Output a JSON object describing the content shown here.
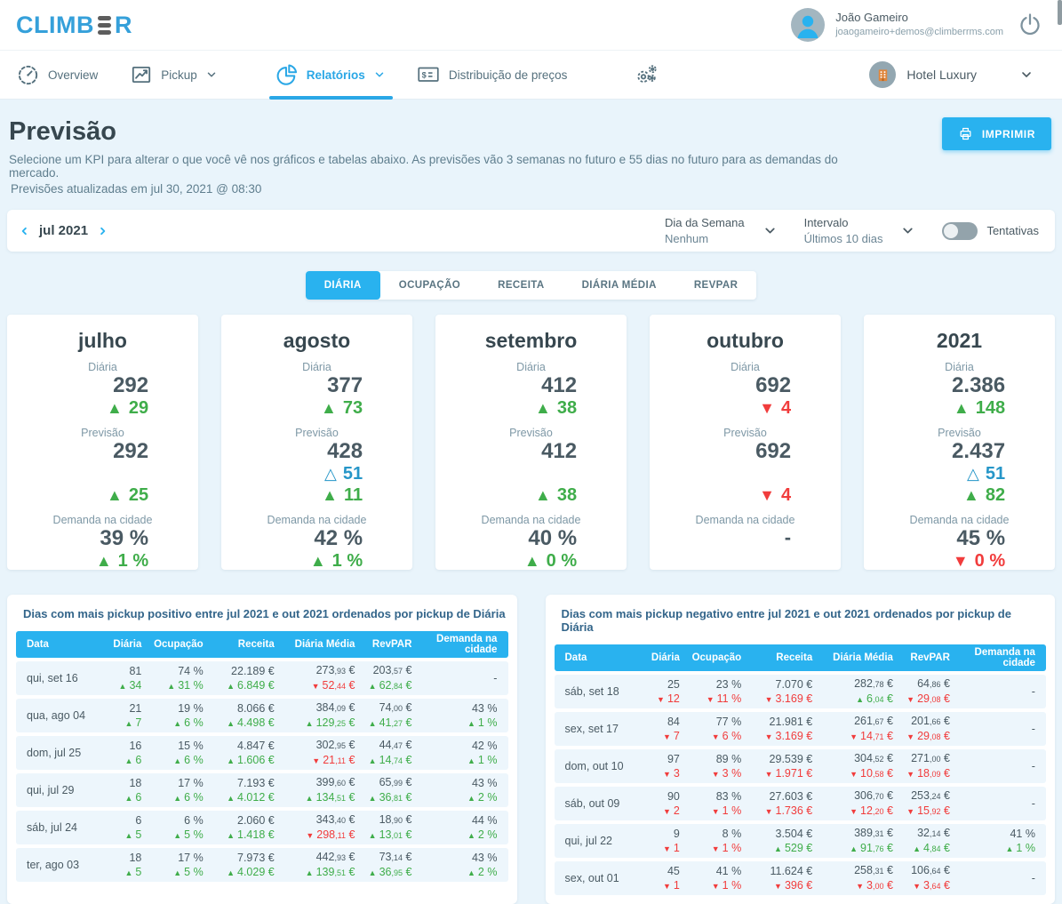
{
  "header": {
    "logo_left": "CLIMB",
    "logo_right": "R",
    "user": {
      "name": "João Gameiro",
      "email": "joaogameiro+demos@climberrms.com"
    }
  },
  "nav": {
    "items": [
      {
        "id": "overview",
        "label": "Overview",
        "icon": "gauge-icon",
        "chevron": false,
        "active": false
      },
      {
        "id": "pickup",
        "label": "Pickup",
        "icon": "line-chart-icon",
        "chevron": true,
        "active": false
      },
      {
        "id": "relatorios",
        "label": "Relatórios",
        "icon": "pie-chart-icon",
        "chevron": true,
        "active": true
      },
      {
        "id": "precos",
        "label": "Distribuição de preços",
        "icon": "price-tag-icon",
        "chevron": false,
        "active": false
      },
      {
        "id": "settings",
        "label": "",
        "icon": "gears-icon",
        "chevron": false,
        "active": false
      }
    ],
    "hotel": {
      "name": "Hotel Luxury"
    }
  },
  "page": {
    "title": "Previsão",
    "subtitle": "Selecione um KPI para alterar o que você vê nos gráficos e tabelas abaixo. As previsões vão 3 semanas no futuro e 55 dias no futuro para as demandas do mercado.",
    "updated": "Previsões atualizadas em jul 30, 2021 @ 08:30",
    "print_label": "IMPRIMIR"
  },
  "filters": {
    "month": "jul 2021",
    "weekday_label": "Dia da Semana",
    "weekday_value": "Nenhum",
    "interval_label": "Intervalo",
    "interval_value": "Últimos 10 dias",
    "toggle_label": "Tentativas",
    "toggle_on": false
  },
  "tabs": {
    "active_index": 0,
    "items": [
      "DIÁRIA",
      "OCUPAÇÃO",
      "RECEITA",
      "DIÁRIA MÉDIA",
      "REVPAR"
    ]
  },
  "card_labels": {
    "daily": "Diária",
    "forecast": "Previsão",
    "demand": "Demanda na cidade"
  },
  "cards": [
    {
      "title": "julho",
      "daily": {
        "value": "292",
        "delta": {
          "dir": "up",
          "style": "green",
          "text": "29"
        }
      },
      "forecast": {
        "value": "292",
        "tentative": null,
        "delta": {
          "dir": "up",
          "style": "green",
          "text": "25"
        }
      },
      "demand": {
        "value": "39 %",
        "delta": {
          "dir": "up",
          "style": "green",
          "text": "1 %"
        }
      }
    },
    {
      "title": "agosto",
      "daily": {
        "value": "377",
        "delta": {
          "dir": "up",
          "style": "green",
          "text": "73"
        }
      },
      "forecast": {
        "value": "428",
        "tentative": {
          "text": "51"
        },
        "delta": {
          "dir": "up",
          "style": "green",
          "text": "11"
        }
      },
      "demand": {
        "value": "42 %",
        "delta": {
          "dir": "up",
          "style": "green",
          "text": "1 %"
        }
      }
    },
    {
      "title": "setembro",
      "daily": {
        "value": "412",
        "delta": {
          "dir": "up",
          "style": "green",
          "text": "38"
        }
      },
      "forecast": {
        "value": "412",
        "tentative": null,
        "delta": {
          "dir": "up",
          "style": "green",
          "text": "38"
        }
      },
      "demand": {
        "value": "40 %",
        "delta": {
          "dir": "up",
          "style": "green",
          "text": "0 %"
        }
      }
    },
    {
      "title": "outubro",
      "daily": {
        "value": "692",
        "delta": {
          "dir": "down",
          "style": "red",
          "text": "4"
        }
      },
      "forecast": {
        "value": "692",
        "tentative": null,
        "delta": {
          "dir": "down",
          "style": "red",
          "text": "4"
        }
      },
      "demand": {
        "value": "-",
        "delta": null
      }
    },
    {
      "title": "2021",
      "daily": {
        "value": "2.386",
        "delta": {
          "dir": "up",
          "style": "green",
          "text": "148"
        }
      },
      "forecast": {
        "value": "2.437",
        "tentative": {
          "text": "51"
        },
        "delta": {
          "dir": "up",
          "style": "green",
          "text": "82"
        }
      },
      "demand": {
        "value": "45 %",
        "delta": {
          "dir": "down",
          "style": "red",
          "text": "0 %"
        }
      }
    }
  ],
  "tables": [
    {
      "title": "Dias com mais pickup positivo entre jul 2021 e out 2021 ordenados por pickup de Diária",
      "columns": [
        "Data",
        "Diária",
        "Ocupação",
        "Receita",
        "Diária Média",
        "RevPAR",
        "Demanda na cidade"
      ],
      "rows": [
        {
          "date": "qui, set 16",
          "cells": [
            {
              "v": "81",
              "d": "34",
              "dir": "up",
              "c": "green"
            },
            {
              "v": "74 %",
              "d": "31 %",
              "dir": "up",
              "c": "green"
            },
            {
              "v": "22.189 €",
              "d": "6.849 €",
              "dir": "up",
              "c": "green"
            },
            {
              "v": "273,93 €",
              "d": "52,44 €",
              "dir": "down",
              "c": "red"
            },
            {
              "v": "203,57 €",
              "d": "62,84 €",
              "dir": "up",
              "c": "green"
            },
            {
              "v": "-"
            }
          ]
        },
        {
          "date": "qua, ago 04",
          "cells": [
            {
              "v": "21",
              "d": "7",
              "dir": "up",
              "c": "green"
            },
            {
              "v": "19 %",
              "d": "6 %",
              "dir": "up",
              "c": "green"
            },
            {
              "v": "8.066 €",
              "d": "4.498 €",
              "dir": "up",
              "c": "green"
            },
            {
              "v": "384,09 €",
              "d": "129,25 €",
              "dir": "up",
              "c": "green"
            },
            {
              "v": "74,00 €",
              "d": "41,27 €",
              "dir": "up",
              "c": "green"
            },
            {
              "v": "43 %",
              "d": "1 %",
              "dir": "up",
              "c": "green"
            }
          ]
        },
        {
          "date": "dom, jul 25",
          "cells": [
            {
              "v": "16",
              "d": "6",
              "dir": "up",
              "c": "green"
            },
            {
              "v": "15 %",
              "d": "6 %",
              "dir": "up",
              "c": "green"
            },
            {
              "v": "4.847 €",
              "d": "1.606 €",
              "dir": "up",
              "c": "green"
            },
            {
              "v": "302,95 €",
              "d": "21,11 €",
              "dir": "down",
              "c": "red"
            },
            {
              "v": "44,47 €",
              "d": "14,74 €",
              "dir": "up",
              "c": "green"
            },
            {
              "v": "42 %",
              "d": "1 %",
              "dir": "up",
              "c": "green"
            }
          ]
        },
        {
          "date": "qui, jul 29",
          "cells": [
            {
              "v": "18",
              "d": "6",
              "dir": "up",
              "c": "green"
            },
            {
              "v": "17 %",
              "d": "6 %",
              "dir": "up",
              "c": "green"
            },
            {
              "v": "7.193 €",
              "d": "4.012 €",
              "dir": "up",
              "c": "green"
            },
            {
              "v": "399,60 €",
              "d": "134,51 €",
              "dir": "up",
              "c": "green"
            },
            {
              "v": "65,99 €",
              "d": "36,81 €",
              "dir": "up",
              "c": "green"
            },
            {
              "v": "43 %",
              "d": "2 %",
              "dir": "up",
              "c": "green"
            }
          ]
        },
        {
          "date": "sáb, jul 24",
          "cells": [
            {
              "v": "6",
              "d": "5",
              "dir": "up",
              "c": "green"
            },
            {
              "v": "6 %",
              "d": "5 %",
              "dir": "up",
              "c": "green"
            },
            {
              "v": "2.060 €",
              "d": "1.418 €",
              "dir": "up",
              "c": "green"
            },
            {
              "v": "343,40 €",
              "d": "298,11 €",
              "dir": "down",
              "c": "red"
            },
            {
              "v": "18,90 €",
              "d": "13,01 €",
              "dir": "up",
              "c": "green"
            },
            {
              "v": "44 %",
              "d": "2 %",
              "dir": "up",
              "c": "green"
            }
          ]
        },
        {
          "date": "ter, ago 03",
          "cells": [
            {
              "v": "18",
              "d": "5",
              "dir": "up",
              "c": "green"
            },
            {
              "v": "17 %",
              "d": "5 %",
              "dir": "up",
              "c": "green"
            },
            {
              "v": "7.973 €",
              "d": "4.029 €",
              "dir": "up",
              "c": "green"
            },
            {
              "v": "442,93 €",
              "d": "139,51 €",
              "dir": "up",
              "c": "green"
            },
            {
              "v": "73,14 €",
              "d": "36,95 €",
              "dir": "up",
              "c": "green"
            },
            {
              "v": "43 %",
              "d": "2 %",
              "dir": "up",
              "c": "green"
            }
          ]
        }
      ]
    },
    {
      "title": "Dias com mais pickup negativo entre jul 2021 e out 2021 ordenados por pickup de Diária",
      "columns": [
        "Data",
        "Diária",
        "Ocupação",
        "Receita",
        "Diária Média",
        "RevPAR",
        "Demanda na cidade"
      ],
      "rows": [
        {
          "date": "sáb, set 18",
          "cells": [
            {
              "v": "25",
              "d": "12",
              "dir": "down",
              "c": "red"
            },
            {
              "v": "23 %",
              "d": "11 %",
              "dir": "down",
              "c": "red"
            },
            {
              "v": "7.070 €",
              "d": "3.169 €",
              "dir": "down",
              "c": "red"
            },
            {
              "v": "282,78 €",
              "d": "6,04 €",
              "dir": "up",
              "c": "green"
            },
            {
              "v": "64,86 €",
              "d": "29,08 €",
              "dir": "down",
              "c": "red"
            },
            {
              "v": "-"
            }
          ]
        },
        {
          "date": "sex, set 17",
          "cells": [
            {
              "v": "84",
              "d": "7",
              "dir": "down",
              "c": "red"
            },
            {
              "v": "77 %",
              "d": "6 %",
              "dir": "down",
              "c": "red"
            },
            {
              "v": "21.981 €",
              "d": "3.169 €",
              "dir": "down",
              "c": "red"
            },
            {
              "v": "261,67 €",
              "d": "14,71 €",
              "dir": "down",
              "c": "red"
            },
            {
              "v": "201,66 €",
              "d": "29,08 €",
              "dir": "down",
              "c": "red"
            },
            {
              "v": "-"
            }
          ]
        },
        {
          "date": "dom, out 10",
          "cells": [
            {
              "v": "97",
              "d": "3",
              "dir": "down",
              "c": "red"
            },
            {
              "v": "89 %",
              "d": "3 %",
              "dir": "down",
              "c": "red"
            },
            {
              "v": "29.539 €",
              "d": "1.971 €",
              "dir": "down",
              "c": "red"
            },
            {
              "v": "304,52 €",
              "d": "10,58 €",
              "dir": "down",
              "c": "red"
            },
            {
              "v": "271,00 €",
              "d": "18,09 €",
              "dir": "down",
              "c": "red"
            },
            {
              "v": "-"
            }
          ]
        },
        {
          "date": "sáb, out 09",
          "cells": [
            {
              "v": "90",
              "d": "2",
              "dir": "down",
              "c": "red"
            },
            {
              "v": "83 %",
              "d": "1 %",
              "dir": "down",
              "c": "red"
            },
            {
              "v": "27.603 €",
              "d": "1.736 €",
              "dir": "down",
              "c": "red"
            },
            {
              "v": "306,70 €",
              "d": "12,20 €",
              "dir": "down",
              "c": "red"
            },
            {
              "v": "253,24 €",
              "d": "15,92 €",
              "dir": "down",
              "c": "red"
            },
            {
              "v": "-"
            }
          ]
        },
        {
          "date": "qui, jul 22",
          "cells": [
            {
              "v": "9",
              "d": "1",
              "dir": "down",
              "c": "red"
            },
            {
              "v": "8 %",
              "d": "1 %",
              "dir": "down",
              "c": "red"
            },
            {
              "v": "3.504 €",
              "d": "529 €",
              "dir": "up",
              "c": "green"
            },
            {
              "v": "389,31 €",
              "d": "91,76 €",
              "dir": "up",
              "c": "green"
            },
            {
              "v": "32,14 €",
              "d": "4,84 €",
              "dir": "up",
              "c": "green"
            },
            {
              "v": "41 %",
              "d": "1 %",
              "dir": "up",
              "c": "green"
            }
          ]
        },
        {
          "date": "sex, out 01",
          "cells": [
            {
              "v": "45",
              "d": "1",
              "dir": "down",
              "c": "red"
            },
            {
              "v": "41 %",
              "d": "1 %",
              "dir": "down",
              "c": "red"
            },
            {
              "v": "11.624 €",
              "d": "396 €",
              "dir": "down",
              "c": "red"
            },
            {
              "v": "258,31 €",
              "d": "3,00 €",
              "dir": "down",
              "c": "red"
            },
            {
              "v": "106,64 €",
              "d": "3,64 €",
              "dir": "down",
              "c": "red"
            },
            {
              "v": "-"
            }
          ]
        }
      ]
    }
  ],
  "colors": {
    "accent": "#29b2ef",
    "green": "#3fad4a",
    "red": "#f13c3c",
    "tentative_blue": "#2696c8",
    "dark": "#37474f"
  }
}
